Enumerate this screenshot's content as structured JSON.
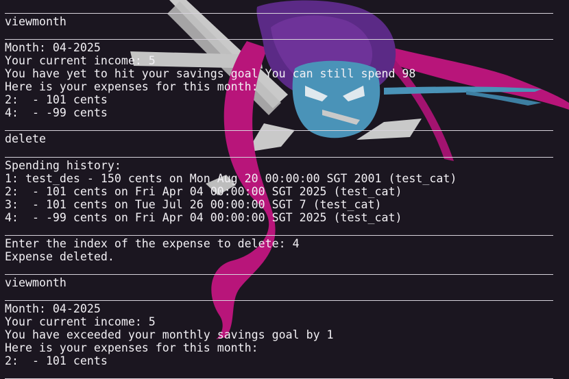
{
  "terminal": {
    "lines": [
      {
        "type": "rule"
      },
      {
        "type": "text",
        "text": "viewmonth"
      },
      {
        "type": "rule"
      },
      {
        "type": "text",
        "text": "Month: 04-2025"
      },
      {
        "type": "text",
        "text": "Your current income: 5"
      },
      {
        "type": "text",
        "text": "You have yet to hit your savings goal You can still spend 98"
      },
      {
        "type": "text",
        "text": "Here is your expenses for this month:"
      },
      {
        "type": "text",
        "text": "2:  - 101 cents"
      },
      {
        "type": "text",
        "text": "4:  - -99 cents"
      },
      {
        "type": "rule"
      },
      {
        "type": "text",
        "text": "delete"
      },
      {
        "type": "rule"
      },
      {
        "type": "text",
        "text": "Spending history:"
      },
      {
        "type": "text",
        "text": "1: test_des - 150 cents on Mon Aug 20 00:00:00 SGT 2001 (test_cat)"
      },
      {
        "type": "text",
        "text": "2:  - 101 cents on Fri Apr 04 00:00:00 SGT 2025 (test_cat)"
      },
      {
        "type": "text",
        "text": "3:  - 101 cents on Tue Jul 26 00:00:00 SGT 7 (test_cat)"
      },
      {
        "type": "text",
        "text": "4:  - -99 cents on Fri Apr 04 00:00:00 SGT 2025 (test_cat)"
      },
      {
        "type": "rule"
      },
      {
        "type": "text",
        "text": "Enter the index of the expense to delete: 4"
      },
      {
        "type": "text",
        "text": "Expense deleted."
      },
      {
        "type": "rule"
      },
      {
        "type": "text",
        "text": "viewmonth"
      },
      {
        "type": "rule"
      },
      {
        "type": "text",
        "text": "Month: 04-2025"
      },
      {
        "type": "text",
        "text": "Your current income: 5"
      },
      {
        "type": "text",
        "text": "You have exceeded your monthly savings goal by 1"
      },
      {
        "type": "text",
        "text": "Here is your expenses for this month:"
      },
      {
        "type": "text",
        "text": "2:  - 101 cents"
      },
      {
        "type": "rule"
      }
    ]
  },
  "colors": {
    "background": "#1b1620",
    "text": "#f2f0f4",
    "rule": "#d8d4dc",
    "wallpaper_magenta": "#b8157a",
    "wallpaper_purple": "#5b2a86",
    "wallpaper_teal": "#4a93b8",
    "wallpaper_gray": "#c9c9c9"
  },
  "wallpaper": {
    "icon": "ninja-mascot-icon"
  }
}
